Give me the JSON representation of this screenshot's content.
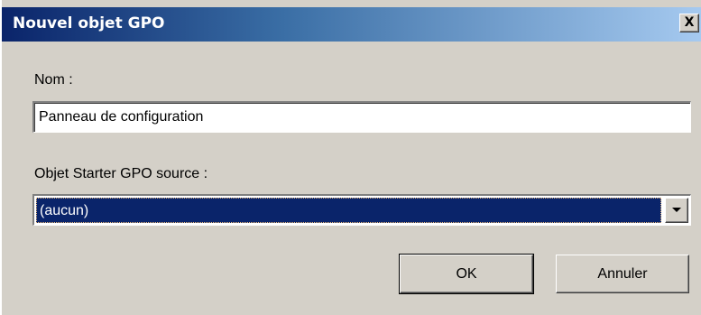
{
  "dialog": {
    "title": "Nouvel objet GPO",
    "close_label": "X"
  },
  "name_field": {
    "label": "Nom :",
    "value": "Panneau de configuration"
  },
  "source_field": {
    "label": "Objet Starter GPO source :",
    "selected": "(aucun)"
  },
  "buttons": {
    "ok_label": "OK",
    "cancel_label": "Annuler"
  },
  "colors": {
    "titlebar_start": "#0a246a",
    "titlebar_end": "#a6caf0",
    "dialog_background": "#d4d0c8",
    "selection_background": "#0a246a"
  }
}
